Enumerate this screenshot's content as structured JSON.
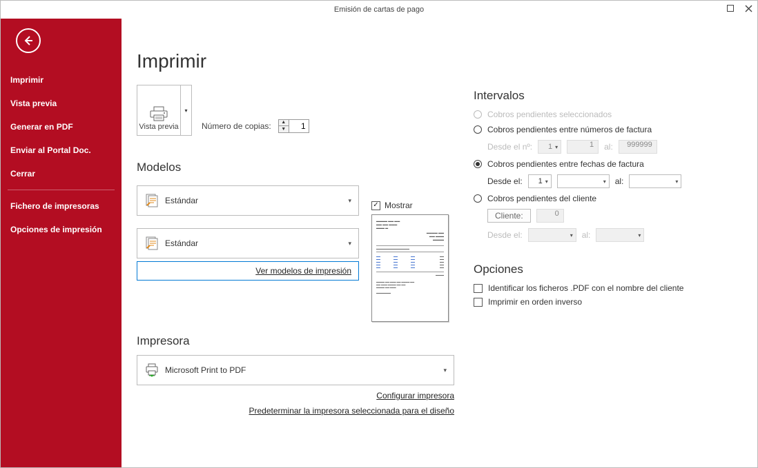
{
  "window": {
    "title": "Emisión de cartas de pago"
  },
  "sidebar": {
    "items": [
      {
        "label": "Imprimir"
      },
      {
        "label": "Vista previa"
      },
      {
        "label": "Generar en PDF"
      },
      {
        "label": "Enviar al Portal Doc."
      },
      {
        "label": "Cerrar"
      }
    ],
    "items2": [
      {
        "label": "Fichero de impresoras"
      },
      {
        "label": "Opciones de impresión"
      }
    ]
  },
  "page": {
    "title": "Imprimir",
    "preview_btn": "Vista previa",
    "copies_label": "Número de copias:",
    "copies_value": "1"
  },
  "modelos": {
    "heading": "Modelos",
    "model1": "Estándar",
    "model2": "Estándar",
    "link": "Ver modelos de impresión",
    "mostrar": "Mostrar"
  },
  "impresora": {
    "heading": "Impresora",
    "name": "Microsoft Print to PDF",
    "config_link": "Configurar impresora",
    "default_link": "Predeterminar la impresora seleccionada para el diseño"
  },
  "intervalos": {
    "heading": "Intervalos",
    "r1": "Cobros pendientes seleccionados",
    "r2": "Cobros pendientes entre números de factura",
    "r2_from": "Desde el nº:",
    "r2_from_v": "1",
    "r2_to_v": "1",
    "r2_al": "al:",
    "r2_max": "999999",
    "r3": "Cobros pendientes entre fechas de factura",
    "r3_from": "Desde el:",
    "r3_from_v": "1",
    "r3_al": "al:",
    "r4": "Cobros pendientes del cliente",
    "r4_cliente": "Cliente:",
    "r4_cliente_v": "0",
    "r4_from": "Desde el:",
    "r4_al": "al:"
  },
  "opciones": {
    "heading": "Opciones",
    "o1": "Identificar los ficheros .PDF con el nombre del cliente",
    "o2": "Imprimir en orden inverso"
  }
}
